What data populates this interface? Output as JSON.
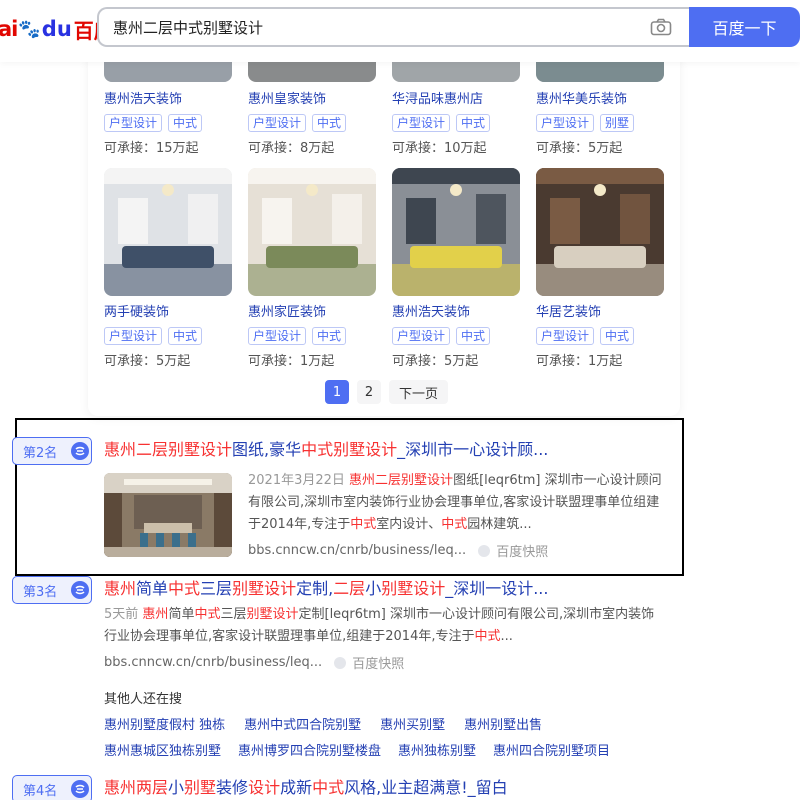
{
  "header": {
    "logo": {
      "ai": "ai",
      "du": "du",
      "baidu": "百度"
    },
    "search_value": "惠州二层中式别墅设计",
    "search_button": "百度一下"
  },
  "shops": [
    {
      "name": "惠州浩天装饰",
      "tags": [
        "户型设计",
        "中式"
      ],
      "price": "可承接：15万起"
    },
    {
      "name": "惠州皇家装饰",
      "tags": [
        "户型设计",
        "中式"
      ],
      "price": "可承接：8万起"
    },
    {
      "name": "华浔品味惠州店",
      "tags": [
        "户型设计",
        "中式"
      ],
      "price": "可承接：10万起"
    },
    {
      "name": "惠州华美乐装饰",
      "tags": [
        "户型设计",
        "别墅"
      ],
      "price": "可承接：5万起"
    },
    {
      "name": "两手硬装饰",
      "tags": [
        "户型设计",
        "中式"
      ],
      "price": "可承接：5万起"
    },
    {
      "name": "惠州家匠装饰",
      "tags": [
        "户型设计",
        "中式"
      ],
      "price": "可承接：1万起"
    },
    {
      "name": "惠州浩天装饰",
      "tags": [
        "户型设计",
        "中式"
      ],
      "price": "可承接：5万起"
    },
    {
      "name": "华居艺装饰",
      "tags": [
        "户型设计",
        "中式"
      ],
      "price": "可承接：1万起"
    }
  ],
  "pager": {
    "p1": "1",
    "p2": "2",
    "next": "下一页"
  },
  "results": [
    {
      "rank": "第2名",
      "title_parts": [
        [
          "惠州二层别墅设计",
          true
        ],
        [
          "图纸,豪华",
          false
        ],
        [
          "中式别墅设计",
          true
        ],
        [
          "_深圳市一心设计顾...",
          false
        ]
      ],
      "date": "2021年3月22日",
      "snippet_parts": [
        [
          "惠州二层别墅设计",
          true
        ],
        [
          "图纸[leqr6tm] 深圳市一心设计顾问有限公司,深圳市室内装饰行业协会理事单位,客家设计联盟理事单位组建于2014年,专注于",
          false
        ],
        [
          "中式",
          true
        ],
        [
          "室内设计、",
          false
        ],
        [
          "中式",
          true
        ],
        [
          "园林建筑...",
          false
        ]
      ],
      "url": "bbs.cnncw.cn/cnrb/business/leq...",
      "kuaizhao": "百度快照"
    },
    {
      "rank": "第3名",
      "title_parts": [
        [
          "惠州",
          true
        ],
        [
          "简单",
          false
        ],
        [
          "中式",
          true
        ],
        [
          "三层",
          false
        ],
        [
          "别墅设计",
          true
        ],
        [
          "定制,",
          false
        ],
        [
          "二层",
          true
        ],
        [
          "小",
          false
        ],
        [
          "别墅设计",
          true
        ],
        [
          "_深圳一设计...",
          false
        ]
      ],
      "date": "5天前",
      "snippet_parts": [
        [
          "惠州",
          true
        ],
        [
          "简单",
          false
        ],
        [
          "中式",
          true
        ],
        [
          "三层",
          false
        ],
        [
          "别墅设计",
          true
        ],
        [
          "定制[leqr6tm] 深圳市一心设计顾问有限公司,深圳市室内装饰行业协会理事单位,客家设计联盟理事单位,组建于2014年,专注于",
          false
        ],
        [
          "中式",
          true
        ],
        [
          "...",
          false
        ]
      ],
      "url": "bbs.cnncw.cn/cnrb/business/leq...",
      "kuaizhao": "百度快照"
    },
    {
      "rank": "第4名",
      "title_parts": [
        [
          "惠州两层",
          true
        ],
        [
          "小",
          false
        ],
        [
          "别墅",
          true
        ],
        [
          "装修",
          false
        ],
        [
          "设计",
          true
        ],
        [
          "成新",
          false
        ],
        [
          "中式",
          true
        ],
        [
          "风格,业主超满意!_留白",
          false
        ]
      ]
    }
  ],
  "others": {
    "title": "其他人还在搜",
    "row1": [
      "惠州别墅度假村 独栋",
      "惠州中式四合院别墅",
      "惠州买别墅",
      "惠州别墅出售"
    ],
    "row2": [
      "惠州惠城区独栋别墅",
      "惠州博罗四合院别墅楼盘",
      "惠州独栋别墅",
      "惠州四合院别墅项目"
    ]
  },
  "colors": {
    "accent": "#4e6ef2",
    "link": "#2440b3",
    "highlight": "#f73131"
  }
}
